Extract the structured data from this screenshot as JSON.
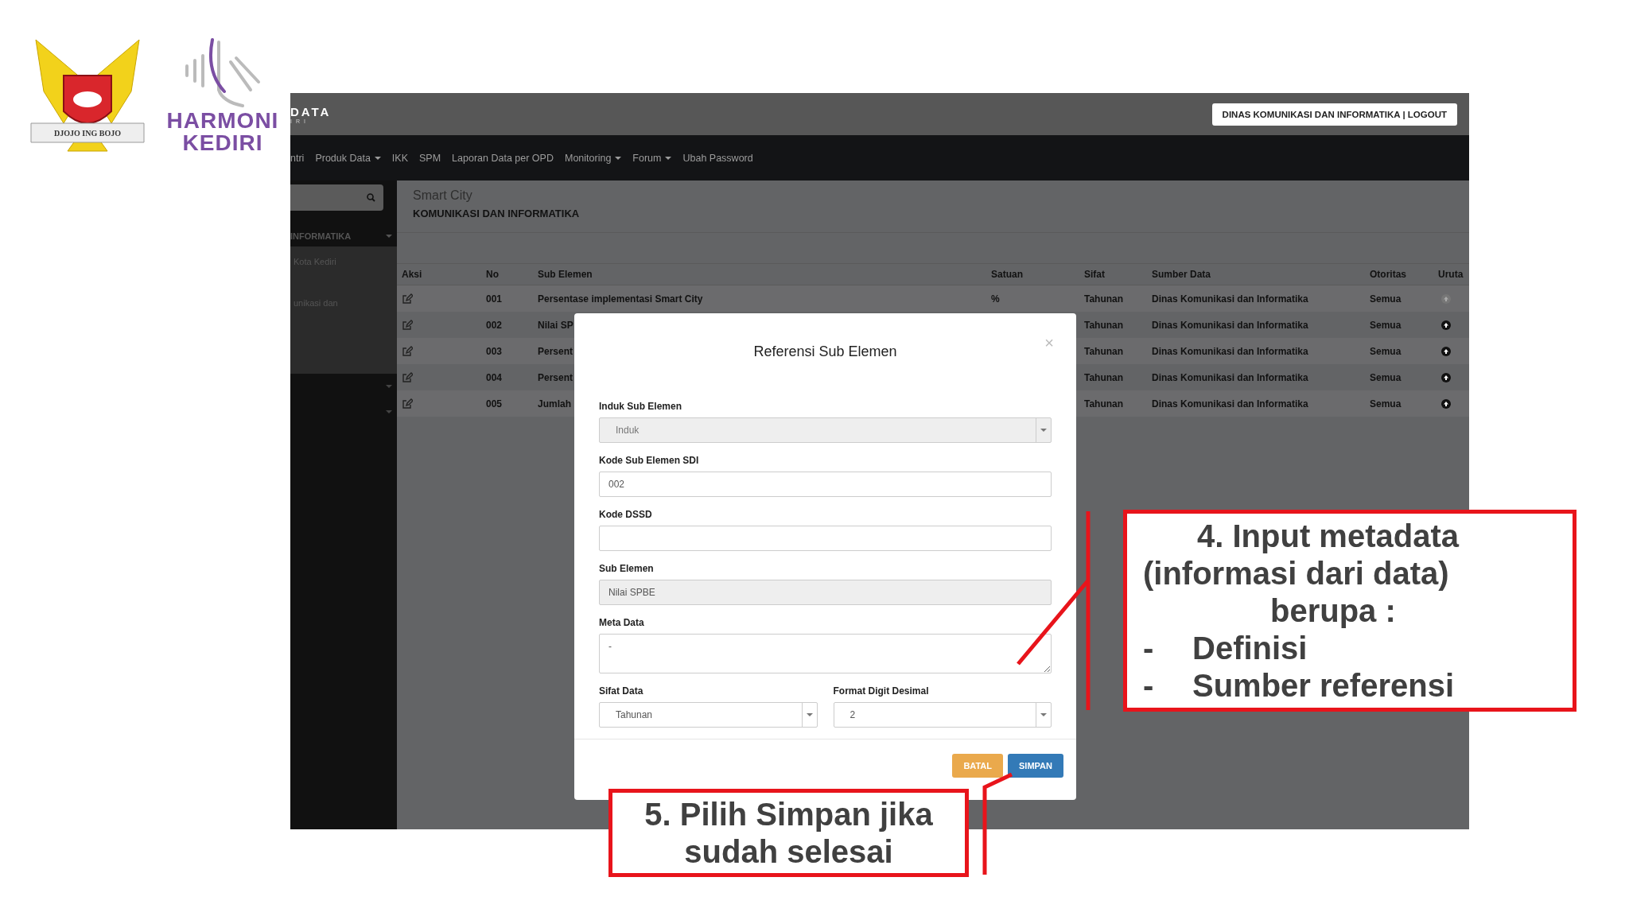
{
  "logos": {
    "emblem_motto": "DJOJO ING BOJO",
    "brand_line1": "HARMONI",
    "brand_line2": "KEDIRI"
  },
  "app": {
    "brand": "DATA",
    "brand_sub": "IRI",
    "account_button": "DINAS KOMUNIKASI DAN INFORMATIKA | LOGOUT",
    "nav": [
      {
        "label": "ntri",
        "dropdown": false
      },
      {
        "label": "Produk Data",
        "dropdown": true
      },
      {
        "label": "IKK",
        "dropdown": false
      },
      {
        "label": "SPM",
        "dropdown": false
      },
      {
        "label": "Laporan Data per OPD",
        "dropdown": false
      },
      {
        "label": "Monitoring",
        "dropdown": true
      },
      {
        "label": "Forum",
        "dropdown": true
      },
      {
        "label": "Ubah Password",
        "dropdown": false
      }
    ],
    "sidebar": {
      "items": [
        {
          "label": "INFORMATIKA",
          "kind": "header"
        },
        {
          "label": "Kota Kediri",
          "kind": "link"
        },
        {
          "label": "unikasi dan",
          "kind": "link"
        }
      ]
    },
    "page": {
      "title": "Smart City",
      "subtitle": "KOMUNIKASI DAN INFORMATIKA"
    },
    "table": {
      "columns": [
        "Aksi",
        "No",
        "Sub Elemen",
        "Satuan",
        "Sifat",
        "Sumber Data",
        "Otoritas",
        "Uruta"
      ],
      "rows": [
        {
          "no": "001",
          "sub_elemen": "Persentase implementasi Smart City",
          "satuan": "%",
          "sifat": "Tahunan",
          "sumber_data": "Dinas Komunikasi dan Informatika",
          "otoritas": "Semua",
          "move_up_enabled": false
        },
        {
          "no": "002",
          "sub_elemen": "Nilai SP",
          "sifat": "Tahunan",
          "sumber_data": "Dinas Komunikasi dan Informatika",
          "otoritas": "Semua",
          "move_up_enabled": true
        },
        {
          "no": "003",
          "sub_elemen": "Persent",
          "sifat": "Tahunan",
          "sumber_data": "Dinas Komunikasi dan Informatika",
          "otoritas": "Semua",
          "move_up_enabled": true
        },
        {
          "no": "004",
          "sub_elemen": "Persent",
          "sifat": "Tahunan",
          "sumber_data": "Dinas Komunikasi dan Informatika",
          "otoritas": "Semua",
          "move_up_enabled": true
        },
        {
          "no": "005",
          "sub_elemen": "Jumlah",
          "sifat": "Tahunan",
          "sumber_data": "Dinas Komunikasi dan Informatika",
          "otoritas": "Semua",
          "move_up_enabled": true
        }
      ]
    }
  },
  "modal": {
    "title": "Referensi Sub Elemen",
    "close": "×",
    "fields": [
      {
        "label": "Induk Sub Elemen",
        "kind": "select",
        "value": "Induk",
        "disabled": true
      },
      {
        "label": "Kode Sub Elemen SDI",
        "kind": "input",
        "value": "002",
        "disabled": false
      },
      {
        "label": "Kode DSSD",
        "kind": "input",
        "disabled": false
      },
      {
        "label": "Sub Elemen",
        "kind": "input",
        "value": "Nilai SPBE",
        "disabled": true
      },
      {
        "label": "Meta Data",
        "kind": "textarea",
        "value": "-",
        "disabled": false
      }
    ],
    "half_fields": [
      {
        "label": "Sifat Data",
        "kind": "select",
        "value": "Tahunan",
        "disabled": false
      },
      {
        "label": "Format Digit Desimal",
        "kind": "select",
        "value": "2",
        "disabled": false
      }
    ],
    "buttons": [
      {
        "label": "BATAL",
        "kind": "cancel"
      },
      {
        "label": "SIMPAN",
        "kind": "save"
      }
    ]
  },
  "callouts": [
    {
      "kind": "metadata",
      "lines": [
        "4. Input metadata",
        "(informasi dari data)",
        "berupa :"
      ],
      "bullets": [
        {
          "marker": "-",
          "label": "Definisi"
        },
        {
          "marker": "-",
          "label": "Sumber referensi"
        }
      ]
    },
    {
      "kind": "save",
      "lines": [
        "5. Pilih Simpan jika",
        "sudah selesai"
      ]
    }
  ]
}
